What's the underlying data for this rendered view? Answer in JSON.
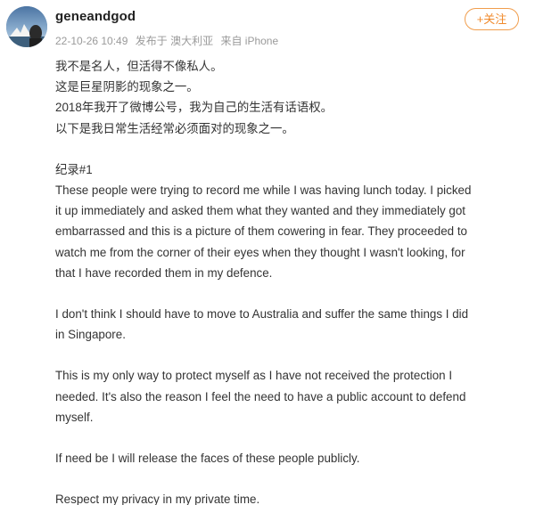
{
  "post": {
    "author": "geneandgod",
    "meta": {
      "time": "22-10-26 10:49",
      "location": "发布于 澳大利亚",
      "source": "来自 iPhone"
    },
    "follow_label": "+关注",
    "paragraphs": [
      [
        "我不是名人，但活得不像私人。",
        "这是巨星阴影的现象之一。",
        "2018年我开了微博公号，我为自己的生活有话语权。",
        "以下是我日常生活经常必须面对的现象之一。"
      ],
      [
        "纪录#1",
        "These people were trying to record me while I was having lunch today. I picked",
        "it up immediately and asked them what they wanted and they immediately got",
        "embarrassed and this is a picture of them cowering in fear. They proceeded to",
        "watch me from the corner of their eyes when they thought I wasn't looking, for",
        "that I have recorded them in my defence."
      ],
      [
        "I don't think I should have to move to Australia and suffer the same things I did",
        "in Singapore."
      ],
      [
        "This is my only way to protect myself as I have not received the protection I",
        "needed. It's also the reason I feel the need to have a public account to defend",
        "myself."
      ],
      [
        "If need be I will release the faces of these people publicly."
      ],
      [
        "Respect my privacy in my private time."
      ]
    ]
  },
  "colors": {
    "accent": "#f08a2c",
    "meta": "#9a9a9a",
    "text": "#333333"
  },
  "icons": {
    "avatar": "avatar-opera-house-photo"
  }
}
